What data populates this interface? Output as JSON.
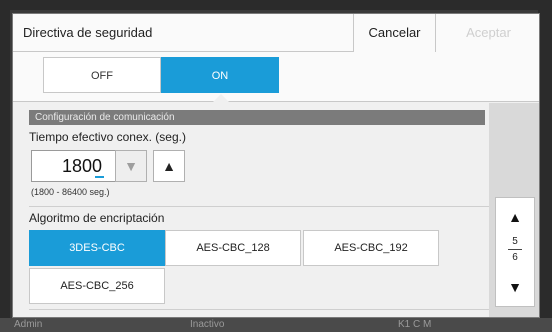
{
  "dialog": {
    "title": "Directiva de seguridad",
    "cancel_label": "Cancelar",
    "accept_label": "Aceptar"
  },
  "toggle": {
    "off_label": "OFF",
    "on_label": "ON",
    "selected": "ON"
  },
  "section": {
    "title": "Configuración de comunicación"
  },
  "timeout": {
    "label": "Tiempo efectivo conex. (seg.)",
    "value": "1800",
    "range": "(1800 - 86400 seg.)",
    "down_icon": "triangle-down",
    "up_icon": "triangle-up"
  },
  "encryption": {
    "label": "Algoritmo de encriptación",
    "options": [
      "3DES-CBC",
      "AES-CBC_128",
      "AES-CBC_192",
      "AES-CBC_256"
    ],
    "selected": "3DES-CBC"
  },
  "pager": {
    "current": "5",
    "total": "6",
    "up_icon": "triangle-up",
    "down_icon": "triangle-down"
  },
  "statusbar": {
    "user": "Admin",
    "state": "Inactivo",
    "ink": "K1 C M"
  },
  "colors": {
    "accent": "#1a9cd8",
    "section_bar": "#7b7b7b"
  }
}
